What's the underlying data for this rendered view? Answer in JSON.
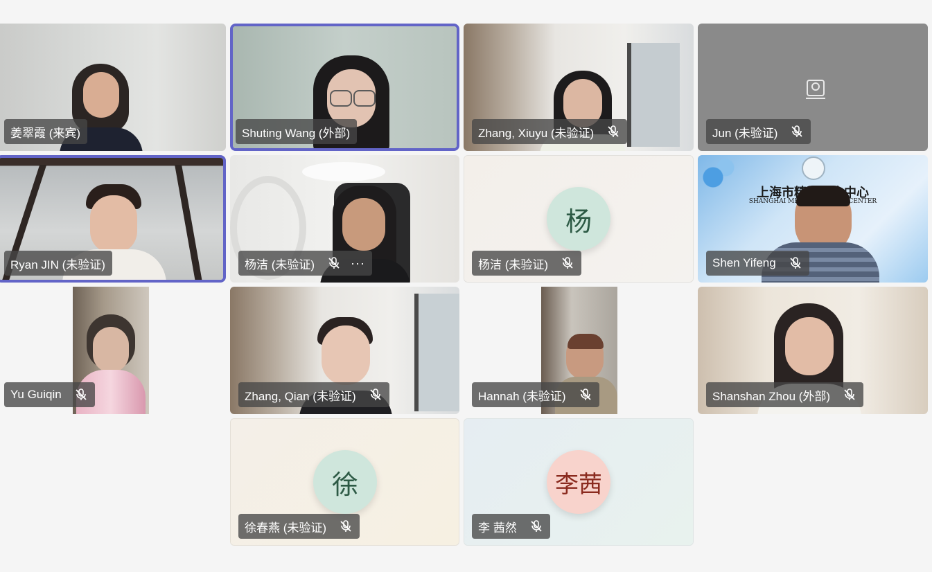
{
  "participants": [
    {
      "name": "姜翠霞 (来宾)",
      "muted": false
    },
    {
      "name": "Shuting Wang (外部)",
      "muted": false,
      "speaking": true
    },
    {
      "name": "Zhang, Xiuyu (未验证)",
      "muted": true
    },
    {
      "name": "Jun (未验证)",
      "muted": true,
      "camera_off": true
    },
    {
      "name": "Ryan JIN (未验证)",
      "muted": false,
      "speaking": true
    },
    {
      "name": "杨洁 (未验证)",
      "muted": true,
      "more_options": "···"
    },
    {
      "name": "杨洁 (未验证)",
      "muted": true,
      "avatar_text": "杨"
    },
    {
      "name": "Shen Yifeng",
      "muted": true,
      "background_text": "上海市精神卫生中心",
      "background_subtext": "SHANGHAI MENTAL HEALTH CENTER"
    },
    {
      "name": "Yu Guiqin",
      "muted": true
    },
    {
      "name": "Zhang, Qian (未验证)",
      "muted": true
    },
    {
      "name": "Hannah (未验证)",
      "muted": true
    },
    {
      "name": "Shanshan Zhou (外部)",
      "muted": true
    },
    {
      "name": "徐春燕 (未验证)",
      "muted": true,
      "avatar_text": "徐"
    },
    {
      "name": "李 茜然",
      "muted": true,
      "avatar_text": "李茜"
    }
  ],
  "icons": {
    "mic_off": "mic-off-icon",
    "camera_off": "camera-off-icon"
  },
  "colors": {
    "speaking_border": "#6264c7",
    "nameplate_bg": "#464646",
    "avatar_green": "#cfe6dc",
    "avatar_pink": "#f8d3cc"
  }
}
